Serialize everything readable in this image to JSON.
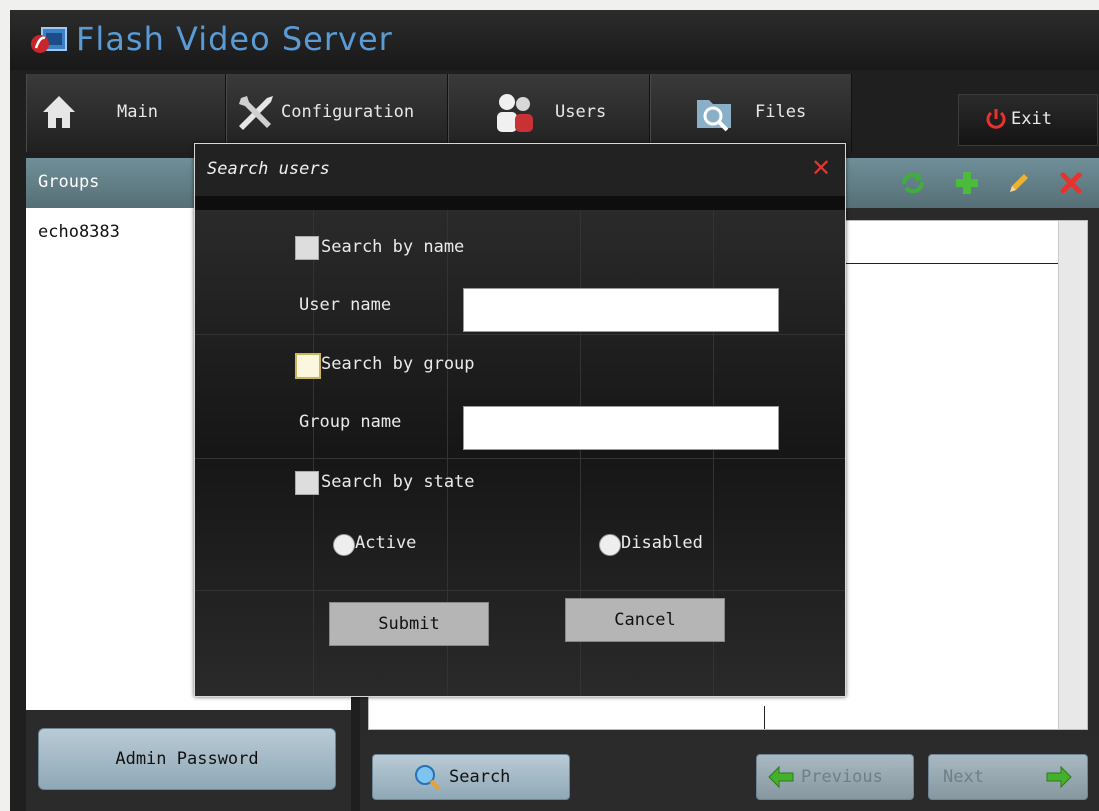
{
  "app": {
    "title": "Flash Video Server"
  },
  "nav": {
    "tabs": [
      {
        "label": "Main",
        "icon": "house-icon"
      },
      {
        "label": "Configuration",
        "icon": "tools-icon"
      },
      {
        "label": "Users",
        "icon": "users-icon"
      },
      {
        "label": "Files",
        "icon": "files-icon"
      }
    ],
    "exit_label": "Exit"
  },
  "groups": {
    "header": "Groups",
    "items": [
      "echo8383"
    ],
    "admin_password_label": "Admin Password"
  },
  "toolbar": {
    "icons": [
      "refresh-icon",
      "add-icon",
      "edit-icon",
      "delete-icon"
    ]
  },
  "bottom": {
    "search_label": "Search",
    "previous_label": "Previous",
    "next_label": "Next"
  },
  "dialog": {
    "title": "Search users",
    "search_by_name_label": "Search by name",
    "user_name_label": "User name",
    "user_name_value": "",
    "search_by_group_label": "Search by group",
    "group_name_label": "Group name",
    "group_name_value": "",
    "search_by_state_label": "Search by state",
    "state_active_label": "Active",
    "state_disabled_label": "Disabled",
    "submit_label": "Submit",
    "cancel_label": "Cancel"
  },
  "colors": {
    "title_blue": "#5a9bd6",
    "header_teal": "#6f8f98",
    "close_red": "#e8322d",
    "exit_red": "#e8322d"
  }
}
